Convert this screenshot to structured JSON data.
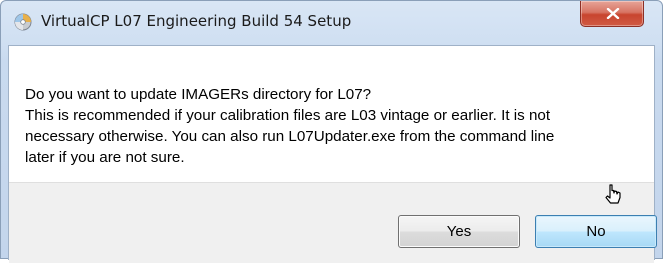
{
  "window": {
    "title": "VirtualCP L07 Engineering Build 54 Setup",
    "close_glyph": "x"
  },
  "message": {
    "lines": [
      "Do you want to update IMAGERs directory for L07?",
      "This is recommended if your calibration files are L03 vintage or earlier. It is not",
      "necessary otherwise. You can also run L07Updater.exe from the command line",
      "later if you are not sure."
    ]
  },
  "buttons": {
    "yes": "Yes",
    "no": "No"
  },
  "icons": {
    "title": "setup-disc-icon",
    "close": "close-icon",
    "cursor": "mouse-pointer-icon"
  },
  "colors": {
    "title_bar": "#d9e6f5",
    "close_button": "#c8452f",
    "default_button_border": "#3c7fb1",
    "button_bar": "#f0f0f0"
  }
}
